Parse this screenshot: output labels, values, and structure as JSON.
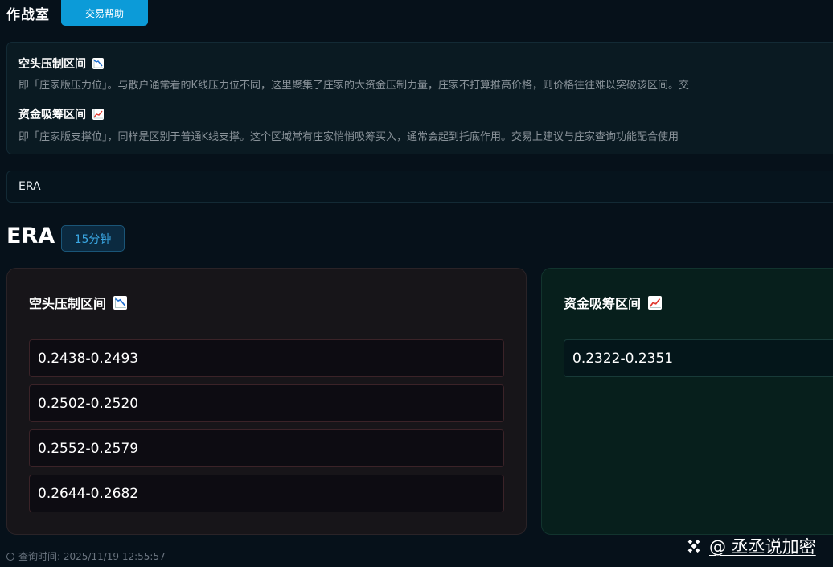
{
  "header": {
    "title": "作战室",
    "help_button": "交易帮助"
  },
  "info": {
    "resistance_heading": "空头压制区间",
    "resistance_icon": "chart-decreasing-icon",
    "resistance_desc": "即「庄家版压力位」。与散户通常看的K线压力位不同，这里聚集了庄家的大资金压制力量，庄家不打算推高价格，则价格往往难以突破该区间。交",
    "support_heading": "资金吸筹区间",
    "support_icon": "chart-increasing-icon",
    "support_desc": "即「庄家版支撑位」，同样是区别于普通K线支撑。这个区域常有庄家悄悄吸筹买入，通常会起到托底作用。交易上建议与庄家查询功能配合使用"
  },
  "search": {
    "value": "ERA"
  },
  "symbol": {
    "name": "ERA",
    "interval": "15分钟"
  },
  "resistance_panel": {
    "title": "空头压制区间",
    "ranges": [
      "0.2438-0.2493",
      "0.2502-0.2520",
      "0.2552-0.2579",
      "0.2644-0.2682"
    ]
  },
  "support_panel": {
    "title": "资金吸筹区间",
    "ranges": [
      "0.2322-0.2351"
    ]
  },
  "footer": {
    "query_time": "查询时间: 2025/11/19 12:55:57",
    "watermark": "@ 丞丞说加密"
  },
  "colors": {
    "background": "#06111a",
    "accent": "#0c9bd8",
    "resistance_panel": "#171519",
    "support_panel": "#071f1c"
  }
}
